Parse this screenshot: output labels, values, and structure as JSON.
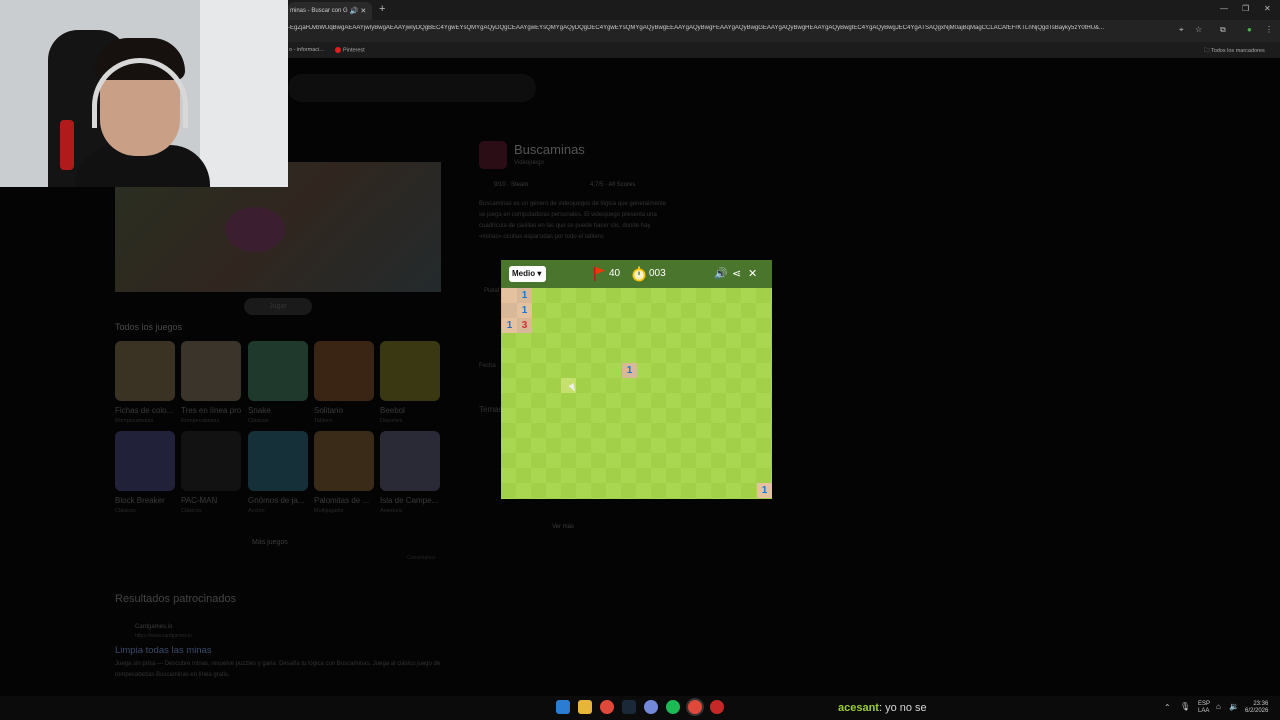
{
  "browser": {
    "tab_title": "minas - Buscar con G",
    "url": "-EgZjaHJvbWUqBwgAEAAYjwIyBwgAEAAYjwIyDQgBEC4YgwEYsQMYgAQyDQgCEAAYgwEYsQMYgAQyDQgDEC4YgwEYsQMYgAQyBwgEEAAYgAQyBwgFEAAYgAQyBwgGEAAYgAQyBwgHEAAYgAQyBwgIEC4YgAQyBwgJEC4YgATSAQgxNjM0ajBqMagCCLACAfEFrKTLnNjQgdTsBayky5zY0tHU&...",
    "bookmarks": [
      "o - informaci...",
      "Pinterest"
    ],
    "bookmarks_folder": "Todos los marcadores"
  },
  "background_page": {
    "play_label": "Jugar",
    "all_games_title": "Todos los juegos",
    "games": [
      {
        "name": "Fichas de colo...",
        "category": "Rompecabezas"
      },
      {
        "name": "Tres en línea pro",
        "category": "Rompecabezas"
      },
      {
        "name": "Snake",
        "category": "Clásicos"
      },
      {
        "name": "Solitario",
        "category": "Tablero"
      },
      {
        "name": "Beebol",
        "category": "Deportes"
      },
      {
        "name": "Block Breaker",
        "category": "Clásicos"
      },
      {
        "name": "PAC-MAN",
        "category": "Clásicos"
      },
      {
        "name": "Gnómos de ja...",
        "category": "Acción"
      },
      {
        "name": "Palomitas de ...",
        "category": "Multijugador"
      },
      {
        "name": "Isla de Campe...",
        "category": "Aventura"
      }
    ],
    "more_games": "Más juegos",
    "feedback": "Comentarios",
    "sponsored_title": "Resultados patrocinados",
    "ad_site": "Cardgames.io",
    "ad_url": "https://www.cardgames.io",
    "ad_link": "Limpia todas las minas",
    "ad_desc": "Juega sin prisa — Descubre minas, resuelve puzzles y gana. Desafía tu lógica con Buscaminas. Juega al clásico juego de rompecabezas Buscaminas en línea gratis.",
    "kp_title": "Buscaminas",
    "kp_subtitle": "Videojuego",
    "kp_rating1": "9/10 · Steam",
    "kp_rating2": "4,7/5 · All Scores",
    "kp_para": "Buscaminas es un género de videojuegos de lógica que generalmente se juega en computadoras personales. El videojuego presenta una cuadrícula de casillas en las que se puede hacer clic, donde hay «minas» ocultas esparcidas por todo el tablero.",
    "kp_labels": [
      "Plataf",
      "Fecha",
      "Temas"
    ],
    "see_more": "Ver más"
  },
  "minesweeper": {
    "difficulty": "Medio",
    "flags": "40",
    "timer": "003",
    "colors": {
      "header": "#4a752c",
      "grass_light": "#aad751",
      "grass_dark": "#a2d149",
      "open_light": "#e5c29f",
      "open_dark": "#d7b899",
      "num1": "#1976d2",
      "num3": "#d32f2f"
    },
    "revealed": [
      {
        "row": 0,
        "col": 0,
        "value": ""
      },
      {
        "row": 0,
        "col": 1,
        "value": "1"
      },
      {
        "row": 1,
        "col": 0,
        "value": ""
      },
      {
        "row": 1,
        "col": 1,
        "value": "1"
      },
      {
        "row": 2,
        "col": 0,
        "value": "1"
      },
      {
        "row": 2,
        "col": 1,
        "value": "3"
      },
      {
        "row": 5,
        "col": 8,
        "value": "1"
      },
      {
        "row": 13,
        "col": 17,
        "value": "1"
      }
    ]
  },
  "taskbar": {
    "chat_user": "acesant",
    "chat_message": ": yo no se",
    "lang_top": "ESP",
    "lang_bottom": "LAA",
    "time": "23:36",
    "date": "6/2/2026"
  }
}
